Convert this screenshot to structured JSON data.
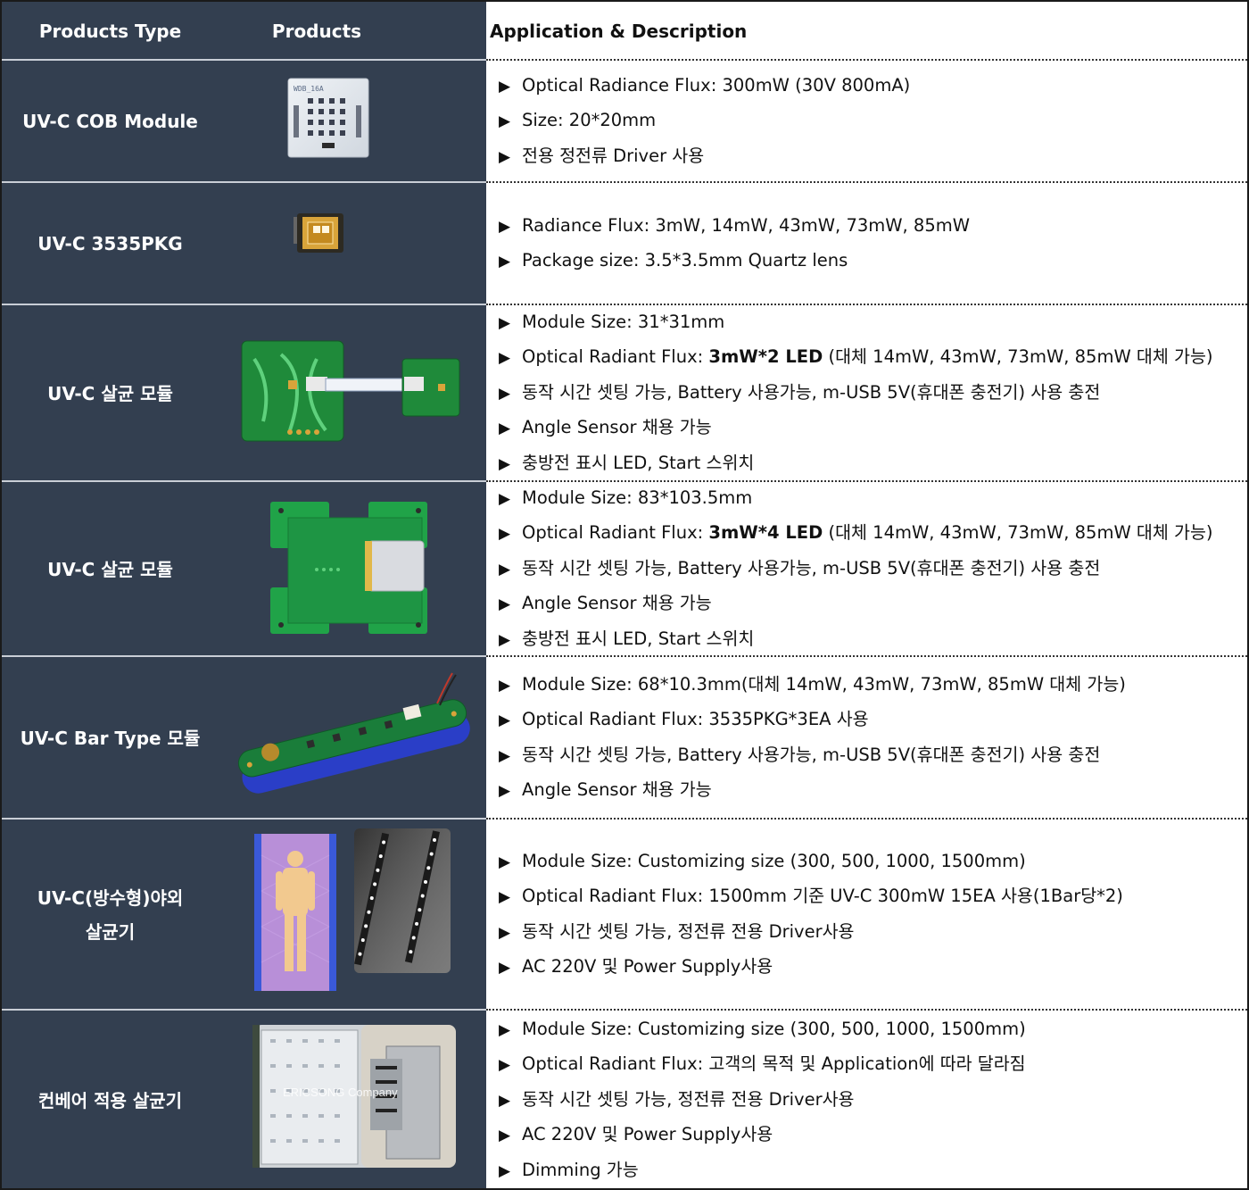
{
  "header": {
    "products_type": "Products Type",
    "products": "Products",
    "application": "Application & Description"
  },
  "bullet": "▶",
  "rows": [
    {
      "type": "UV-C COB Module",
      "product_label": "WDB_16A",
      "items": [
        {
          "text": "Optical Radiance Flux: 300mW (30V 800mA)"
        },
        {
          "text": "Size: 20*20mm"
        },
        {
          "text": "전용 정전류 Driver 사용"
        }
      ]
    },
    {
      "type": "UV-C 3535PKG",
      "items": [
        {
          "text": "Radiance Flux: 3mW, 14mW, 43mW, 73mW, 85mW"
        },
        {
          "text": "Package size: 3.5*3.5mm Quartz lens"
        }
      ]
    },
    {
      "type": "UV-C 살균 모듈",
      "items": [
        {
          "text": "Module Size: 31*31mm"
        },
        {
          "pre": "Optical Radiant Flux: ",
          "bold": "3mW*2 LED",
          "post": " (대체 14mW, 43mW, 73mW, 85mW 대체 가능)"
        },
        {
          "text": "동작 시간 셋팅 가능, Battery 사용가능, m-USB 5V(휴대폰 충전기) 사용 충전"
        },
        {
          "text": "Angle Sensor 채용 가능"
        },
        {
          "text": "충방전 표시 LED, Start 스위치"
        }
      ]
    },
    {
      "type": "UV-C 살균 모듈",
      "items": [
        {
          "text": "Module Size: 83*103.5mm"
        },
        {
          "pre": "Optical Radiant Flux: ",
          "bold": "3mW*4 LED",
          "post": " (대체 14mW, 43mW, 73mW, 85mW 대체 가능)"
        },
        {
          "text": "동작 시간 셋팅 가능, Battery 사용가능, m-USB 5V(휴대폰 충전기) 사용 충전"
        },
        {
          "text": "Angle Sensor 채용 가능"
        },
        {
          "text": "충방전 표시 LED, Start 스위치"
        }
      ]
    },
    {
      "type": "UV-C Bar Type 모듈",
      "items": [
        {
          "text": "Module Size: 68*10.3mm(대체 14mW, 43mW, 73mW, 85mW 대체 가능)"
        },
        {
          "text": "Optical Radiant Flux: 3535PKG*3EA 사용"
        },
        {
          "text": "동작 시간 셋팅 가능, Battery 사용가능, m-USB 5V(휴대폰 충전기) 사용 충전"
        },
        {
          "text": "Angle Sensor 채용 가능"
        }
      ]
    },
    {
      "type_line1": "UV-C(방수형)야외",
      "type_line2": "살균기",
      "items": [
        {
          "text": "Module Size: Customizing size (300, 500, 1000, 1500mm)"
        },
        {
          "text": "Optical Radiant Flux: 1500mm 기준 UV-C 300mW 15EA 사용(1Bar당*2)"
        },
        {
          "text": "동작 시간 셋팅 가능, 정전류 전용 Driver사용"
        },
        {
          "text": "AC 220V 및 Power Supply사용"
        }
      ]
    },
    {
      "type": "컨베어 적용 살균기",
      "watermark": "ERICSONG Company",
      "items": [
        {
          "text": "Module Size: Customizing size (300, 500, 1000, 1500mm)"
        },
        {
          "text": "Optical Radiant Flux: 고객의 목적 및 Application에 따라 달라짐"
        },
        {
          "text": "동작 시간 셋팅 가능, 정전류 전용 Driver사용"
        },
        {
          "text": "AC 220V 및 Power Supply사용"
        },
        {
          "text": "Dimming 가능"
        }
      ]
    }
  ]
}
